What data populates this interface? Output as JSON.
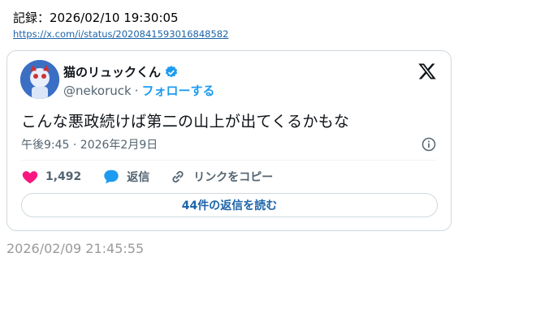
{
  "record": {
    "label": "記録：2026/02/10 19:30:05"
  },
  "url": {
    "text": "https://x.com/i/status/2020841593016848582"
  },
  "tweet": {
    "author_name": "猫のリュックくん",
    "handle": "@nekoruck",
    "separator": "·",
    "follow_label": "フォローする",
    "text": "こんな悪政続けば第二の山上が出てくるかもな",
    "time": "午後9:45 · 2026年2月9日",
    "likes_count": "1,492",
    "reply_label": "返信",
    "copy_link_label": "リンクをコピー",
    "read_replies_label": "44件の返信を読む"
  },
  "footer": {
    "timestamp": "2026/02/09 21:45:55"
  },
  "icons": {
    "verified": "verified-badge-icon",
    "platform": "x-logo-icon",
    "info": "info-icon",
    "like": "heart-icon",
    "reply": "speech-bubble-icon",
    "link": "link-icon"
  },
  "colors": {
    "verified": "#1d9bf0",
    "like": "#f91880",
    "follow": "#1d9bf0",
    "link": "#1d64a8"
  }
}
